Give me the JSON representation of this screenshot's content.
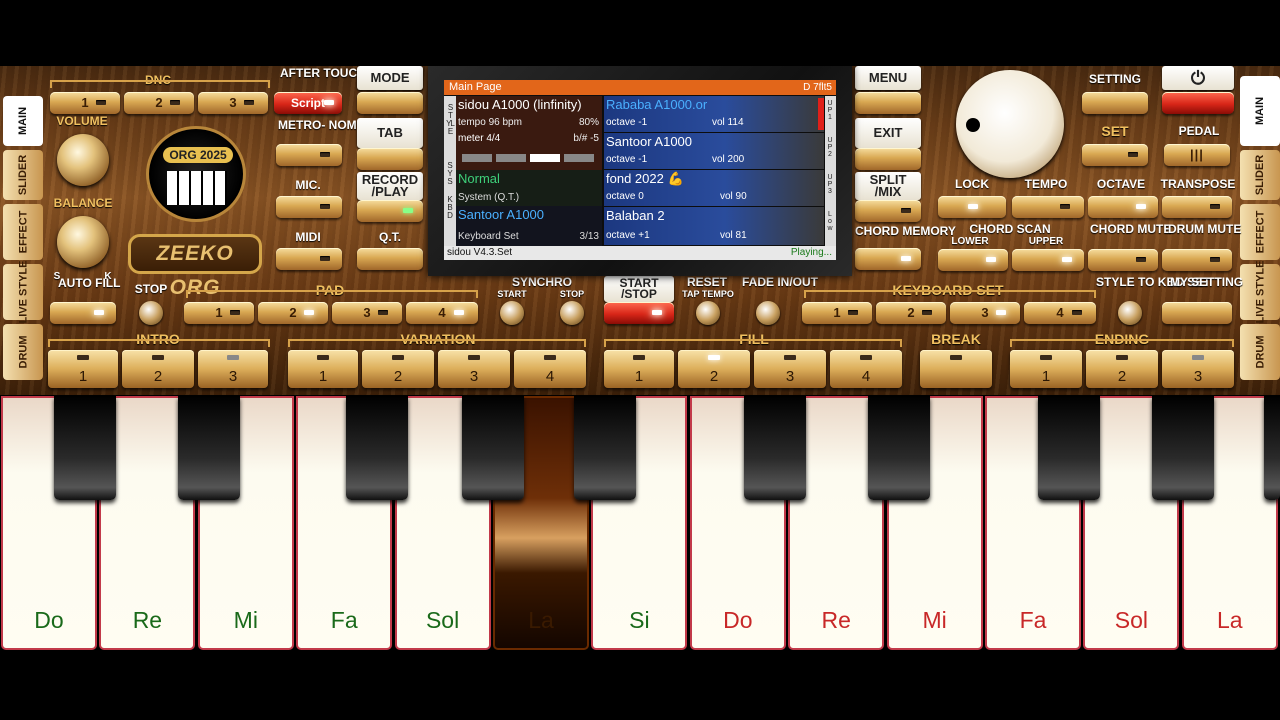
{
  "tabs_left": [
    "MAIN",
    "SLIDER",
    "EFFECT",
    "LIVE STYLE",
    "DRUM"
  ],
  "tabs_right": [
    "MAIN",
    "SLIDER",
    "EFFECT",
    "LIVE STYLE",
    "DRUM"
  ],
  "dnc": {
    "label": "DNC",
    "buttons": [
      "1",
      "2",
      "3"
    ],
    "script": "Script"
  },
  "after_touch": "AFTER TOUCH",
  "volume": "VOLUME",
  "balance": "BALANCE",
  "balance_s": "S",
  "balance_k": "K",
  "logo": "ZEEKO ORG",
  "logo_badge": "ORG 2025",
  "metronome": "METRO- NOME",
  "mic": "MIC.",
  "midi": "MIDI",
  "mode": "MODE",
  "tab": "TAB",
  "record": "RECORD /PLAY",
  "qt": "Q.T.",
  "menu": "MENU",
  "exit": "EXIT",
  "split": "SPLIT /MIX",
  "chord_memory": "CHORD MEMORY",
  "setting": "SETTING",
  "set": "SET",
  "pedal": "PEDAL",
  "lock": "LOCK",
  "tempo": "TEMPO",
  "octave": "OCTAVE",
  "transpose": "TRANSPOSE",
  "chord_scan": "CHORD SCAN",
  "lower": "LOWER",
  "upper": "UPPER",
  "chord_mute": "CHORD MUTE",
  "drum_mute": "DRUM MUTE",
  "auto_fill": "AUTO FILL",
  "stop": "STOP",
  "pad": {
    "label": "PAD",
    "buttons": [
      "1",
      "2",
      "3",
      "4"
    ]
  },
  "synchro": "SYNCHRO",
  "sync_start": "START",
  "sync_stop": "STOP",
  "start_stop": "START /STOP",
  "reset": "RESET",
  "tap_tempo": "TAP TEMPO",
  "fade": "FADE IN/OUT",
  "keyboard_set": {
    "label": "KEYBOARD SET",
    "buttons": [
      "1",
      "2",
      "3",
      "4"
    ]
  },
  "style_to_kbd": "STYLE TO KBD SET",
  "my_setting": "MY SETTING",
  "intro": {
    "label": "INTRO",
    "buttons": [
      "1",
      "2",
      "3"
    ]
  },
  "variation": {
    "label": "VARIATION",
    "buttons": [
      "1",
      "2",
      "3",
      "4"
    ]
  },
  "fill": {
    "label": "FILL",
    "buttons": [
      "1",
      "2",
      "3",
      "4"
    ]
  },
  "break": "BREAK",
  "ending": {
    "label": "ENDING",
    "buttons": [
      "1",
      "2",
      "3"
    ]
  },
  "screen": {
    "header": "Main Page",
    "header_right": "D 7flt5",
    "style_name": "sidou A1000 (linfinity)",
    "tempo": "tempo 96 bpm",
    "percent": "80%",
    "meter": "meter 4/4",
    "bsharp": "b/# -5",
    "sys_mode": "Normal",
    "sys_name": "System (Q.T.)",
    "kbd_name": "Santoor A1000",
    "kbd_set": "Keyboard Set",
    "kbd_count": "3/13",
    "up1_name": "Rababa A1000.or",
    "up1_oct": "octave -1",
    "up1_vol": "vol 114",
    "up2_name": "Santoor A1000",
    "up2_oct": "octave -1",
    "up2_vol": "vol 200",
    "up3_name": "fond 2022 💪",
    "up3_oct": "octave  0",
    "up3_vol": "vol 90",
    "low_name": "Balaban 2",
    "low_oct": "octave +1",
    "low_vol": "vol 81",
    "footer": "sidou V4.3.Set",
    "status": "Playing...",
    "side_style": "STYLE",
    "side_sys": "SYS",
    "side_kbd": "KBD",
    "side_up1": "UP1",
    "side_up2": "UP2",
    "side_up3": "UP3",
    "side_low": "Low"
  },
  "keys": {
    "white": [
      "Do",
      "Re",
      "Mi",
      "Fa",
      "Sol",
      "La",
      "Si",
      "Do",
      "Re",
      "Mi",
      "Fa",
      "Sol",
      "La"
    ],
    "note_colors": [
      "#1a6a1a",
      "#1a6a1a",
      "#1a6a1a",
      "#1a6a1a",
      "#1a6a1a",
      "#1a6a1a",
      "#1a6a1a",
      "#c82828",
      "#c82828",
      "#c82828",
      "#c82828",
      "#c82828",
      "#c82828"
    ]
  }
}
